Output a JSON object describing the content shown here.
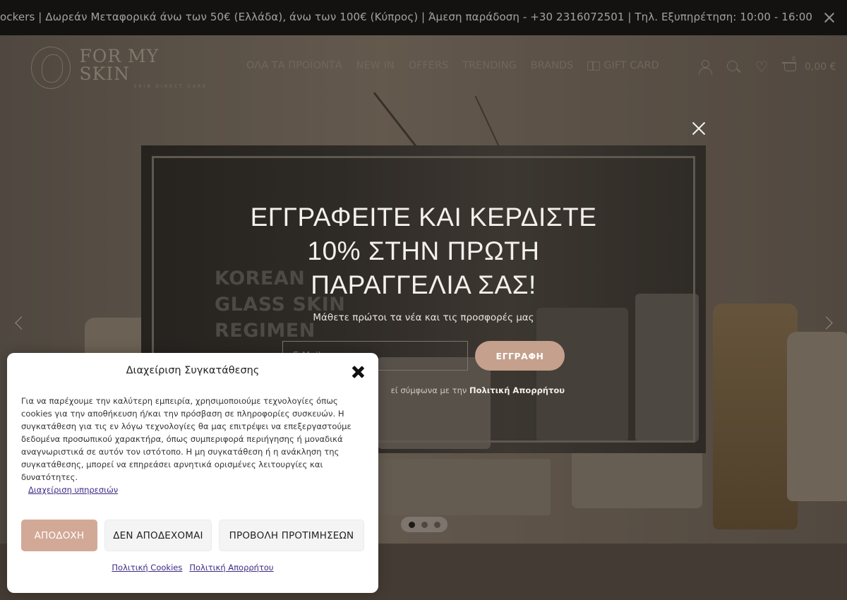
{
  "announcement": {
    "text": "ockers | Δωρεάν Μεταφορικά άνω των 50€ (Ελλάδα), άνω των 100€ (Κύπρος) | Άμεση παράδοση - +30 2316072501 | Τηλ. Εξυπηρέτηση: 10:00 - 16:00"
  },
  "header": {
    "logo_text": "FOR MY SKIN",
    "logo_sub": "SKIN DIRECT CARE",
    "nav": [
      "ΟΛΑ ΤΑ ΠΡΟΪΟΝΤΑ",
      "NEW IN",
      "OFFERS",
      "TRENDING",
      "BRANDS",
      "GIFT CARD"
    ],
    "cart_count": "0",
    "cart_total": "0,00 €"
  },
  "hero": {
    "slides": 3,
    "active_slide": 1
  },
  "newsletter": {
    "background_text": [
      "KOREAN",
      "GLASS SKIN",
      "REGIMEN"
    ],
    "title": "ΕΓΓΡΑΦΕΙΤΕ ΚΑΙ ΚΕΡΔΙΣΤΕ 10% ΣΤΗΝ ΠΡΩΤΗ ΠΑΡΑΓΓΕΛΙΑ ΣΑΣ!",
    "subtitle": "Μάθετε πρώτοι τα νέα και τις προσφορές μας",
    "email_placeholder": "E-Mail",
    "button": "ΕΓΓΡΑΦΗ",
    "consent_prefix": "εί σύμφωνα με την",
    "consent_link": "Πολιτική Απορρήτου"
  },
  "cookie": {
    "title": "Διαχείριση Συγκατάθεσης",
    "body": "Για να παρέχουμε την καλύτερη εμπειρία, χρησιμοποιούμε τεχνολογίες όπως cookies για την αποθήκευση ή/και την πρόσβαση σε πληροφορίες συσκευών. Η συγκατάθεση για τις εν λόγω τεχνολογίες θα μας επιτρέψει να επεξεργαστούμε δεδομένα προσωπικού χαρακτήρα, όπως συμπεριφορά περιήγησης ή μοναδικά αναγνωριστικά σε αυτόν τον ιστότοπο. Η μη συγκατάθεση ή η ανάκληση της συγκατάθεσης, μπορεί να επηρεάσει αρνητικά ορισμένες λειτουργίες και δυνατότητες.",
    "manage_link": "Διαχείριση υπηρεσιών",
    "accept": "ΑΠΟΔΟΧΗ",
    "deny": "ΔΕΝ ΑΠΟΔΕΧΟΜΑΙ",
    "preferences": "ΠΡΟΒΟΛΗ ΠΡΟΤΙΜΗΣΕΩΝ",
    "cookies_policy": "Πολιτική Cookies",
    "privacy_policy": "Πολιτική Απορρήτου"
  },
  "colors": {
    "accent": "#d2a996",
    "link": "#3d2a84",
    "topbar": "#0f0f0f"
  }
}
